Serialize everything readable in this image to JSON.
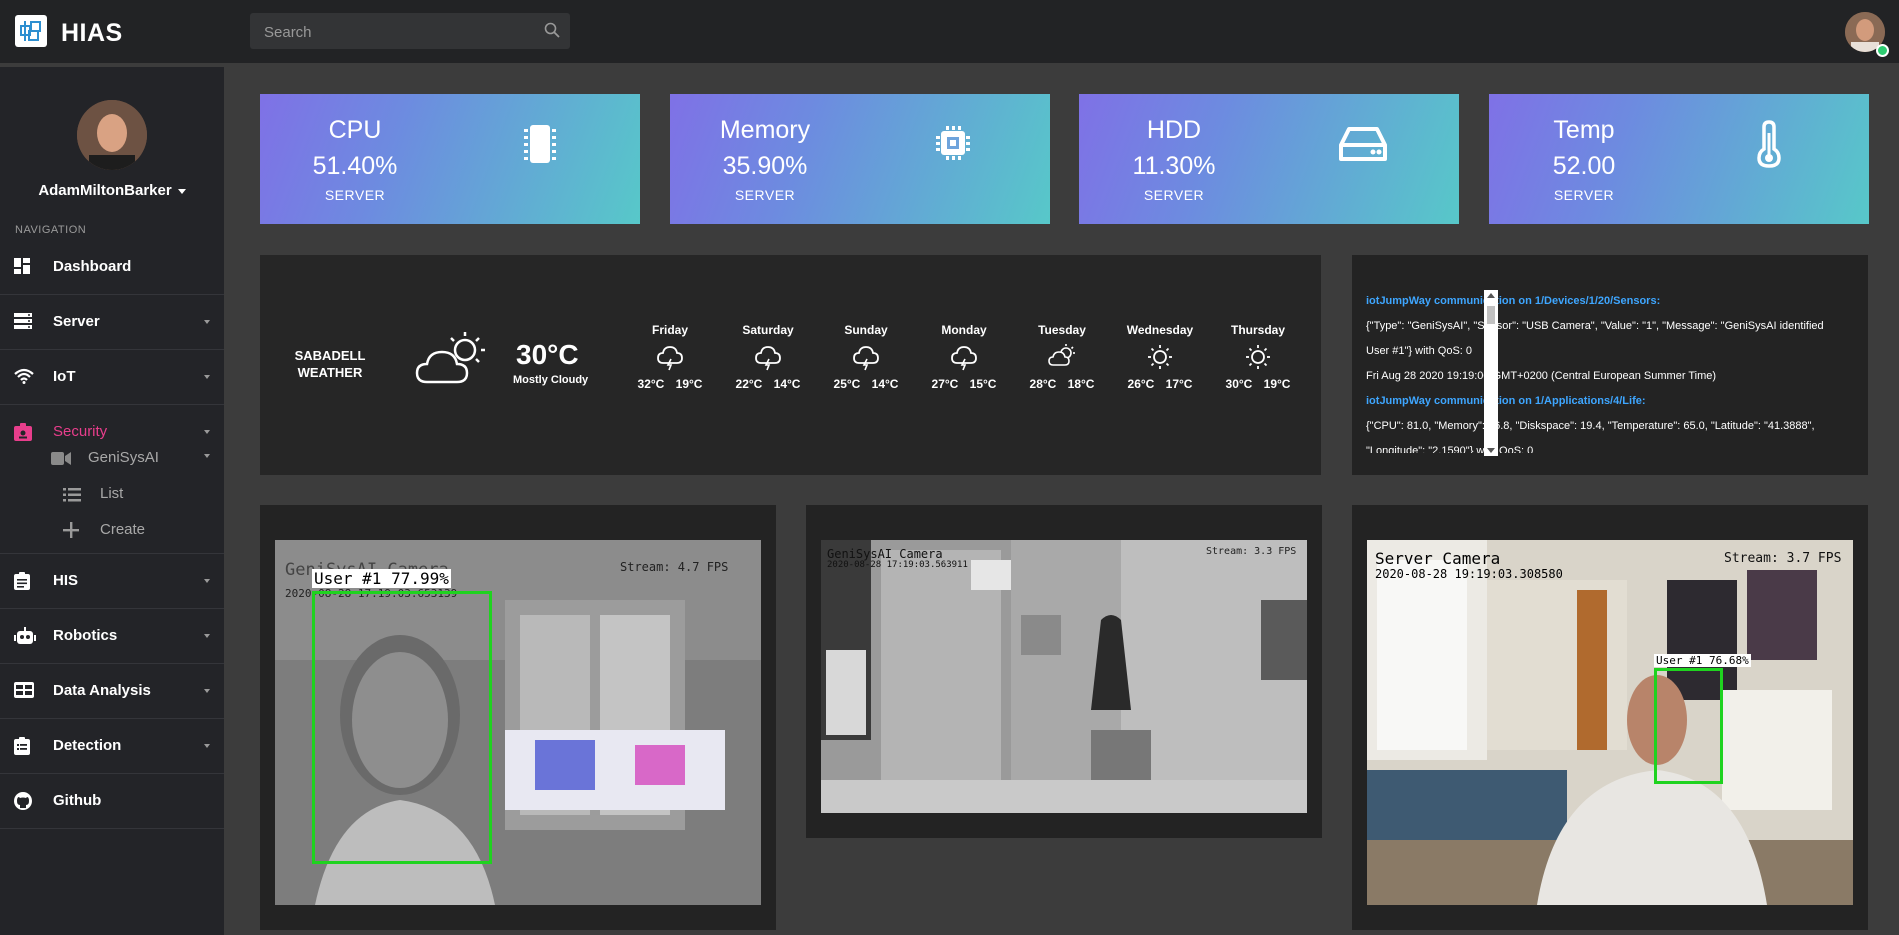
{
  "app": {
    "brand": "HIAS"
  },
  "search": {
    "placeholder": "Search"
  },
  "sidebar": {
    "username": "AdamMiltonBarker",
    "nav_header": "NAVIGATION",
    "items": [
      {
        "label": "Dashboard",
        "icon": "dashboard-icon"
      },
      {
        "label": "Server",
        "icon": "server-icon"
      },
      {
        "label": "IoT",
        "icon": "wifi-icon"
      },
      {
        "label": "Security",
        "icon": "id-badge-icon"
      },
      {
        "label": "HIS",
        "icon": "clipboard-icon"
      },
      {
        "label": "Robotics",
        "icon": "robot-icon"
      },
      {
        "label": "Data Analysis",
        "icon": "table-icon"
      },
      {
        "label": "Detection",
        "icon": "clipboard-list-icon"
      },
      {
        "label": "Github",
        "icon": "github-icon"
      }
    ],
    "security_sub": {
      "group": "GeniSysAI",
      "list": "List",
      "create": "Create"
    },
    "active_color": "#e83e8c"
  },
  "stats": [
    {
      "title": "CPU",
      "value": "51.40%",
      "sub": "SERVER",
      "icon": "cpu-icon"
    },
    {
      "title": "Memory",
      "value": "35.90%",
      "sub": "SERVER",
      "icon": "chip-icon"
    },
    {
      "title": "HDD",
      "value": "11.30%",
      "sub": "SERVER",
      "icon": "hdd-icon"
    },
    {
      "title": "Temp",
      "value": "52.00",
      "sub": "SERVER",
      "icon": "thermometer-icon"
    }
  ],
  "weather": {
    "city_line1": "SABADELL",
    "city_line2": "WEATHER",
    "current_temp": "30°C",
    "current_cond": "Mostly Cloudy",
    "days": [
      {
        "name": "Friday",
        "temps": "32°C 19°C",
        "icon": "rain-cloud-icon"
      },
      {
        "name": "Saturday",
        "temps": "22°C 14°C",
        "icon": "rain-cloud-icon"
      },
      {
        "name": "Sunday",
        "temps": "25°C 14°C",
        "icon": "rain-cloud-icon"
      },
      {
        "name": "Monday",
        "temps": "27°C 15°C",
        "icon": "rain-cloud-icon"
      },
      {
        "name": "Tuesday",
        "temps": "28°C 18°C",
        "icon": "partly-cloudy-icon"
      },
      {
        "name": "Wednesday",
        "temps": "26°C 17°C",
        "icon": "sun-icon"
      },
      {
        "name": "Thursday",
        "temps": "30°C 19°C",
        "icon": "sun-icon"
      }
    ]
  },
  "log": {
    "lines": [
      {
        "head": true,
        "text": "iotJumpWay communication on 1/Devices/1/20/Sensors:"
      },
      {
        "head": false,
        "text": "{\"Type\": \"GeniSysAI\", \"Sensor\": \"USB Camera\", \"Value\": \"1\", \"Message\": \"GeniSysAI identified User #1\"} with QoS: 0"
      },
      {
        "head": false,
        "text": "Fri Aug 28 2020 19:19:00 GMT+0200 (Central European Summer Time)"
      },
      {
        "head": true,
        "text": "iotJumpWay communication on 1/Applications/4/Life:"
      },
      {
        "head": false,
        "text": "{\"CPU\": 81.0, \"Memory\": 26.8, \"Diskspace\": 19.4, \"Temperature\": 65.0, \"Latitude\": \"41.3888\", \"Longitude\": \"2.1590\"} with QoS: 0"
      }
    ]
  },
  "cameras": [
    {
      "title": "GeniSysAI Camera",
      "timestamp": "2020-08-28 17:19:03.653139",
      "stream": "Stream: 4.7 FPS",
      "detection": "User #1 77.99%"
    },
    {
      "title": "GeniSysAI Camera",
      "timestamp": "2020-08-28 17:19:03.563911",
      "stream": "Stream: 3.3 FPS",
      "detection": ""
    },
    {
      "title": "Server Camera",
      "timestamp": "2020-08-28 19:19:03.308580",
      "stream": "Stream: 3.7 FPS",
      "detection": "User #1 76.68%"
    }
  ]
}
